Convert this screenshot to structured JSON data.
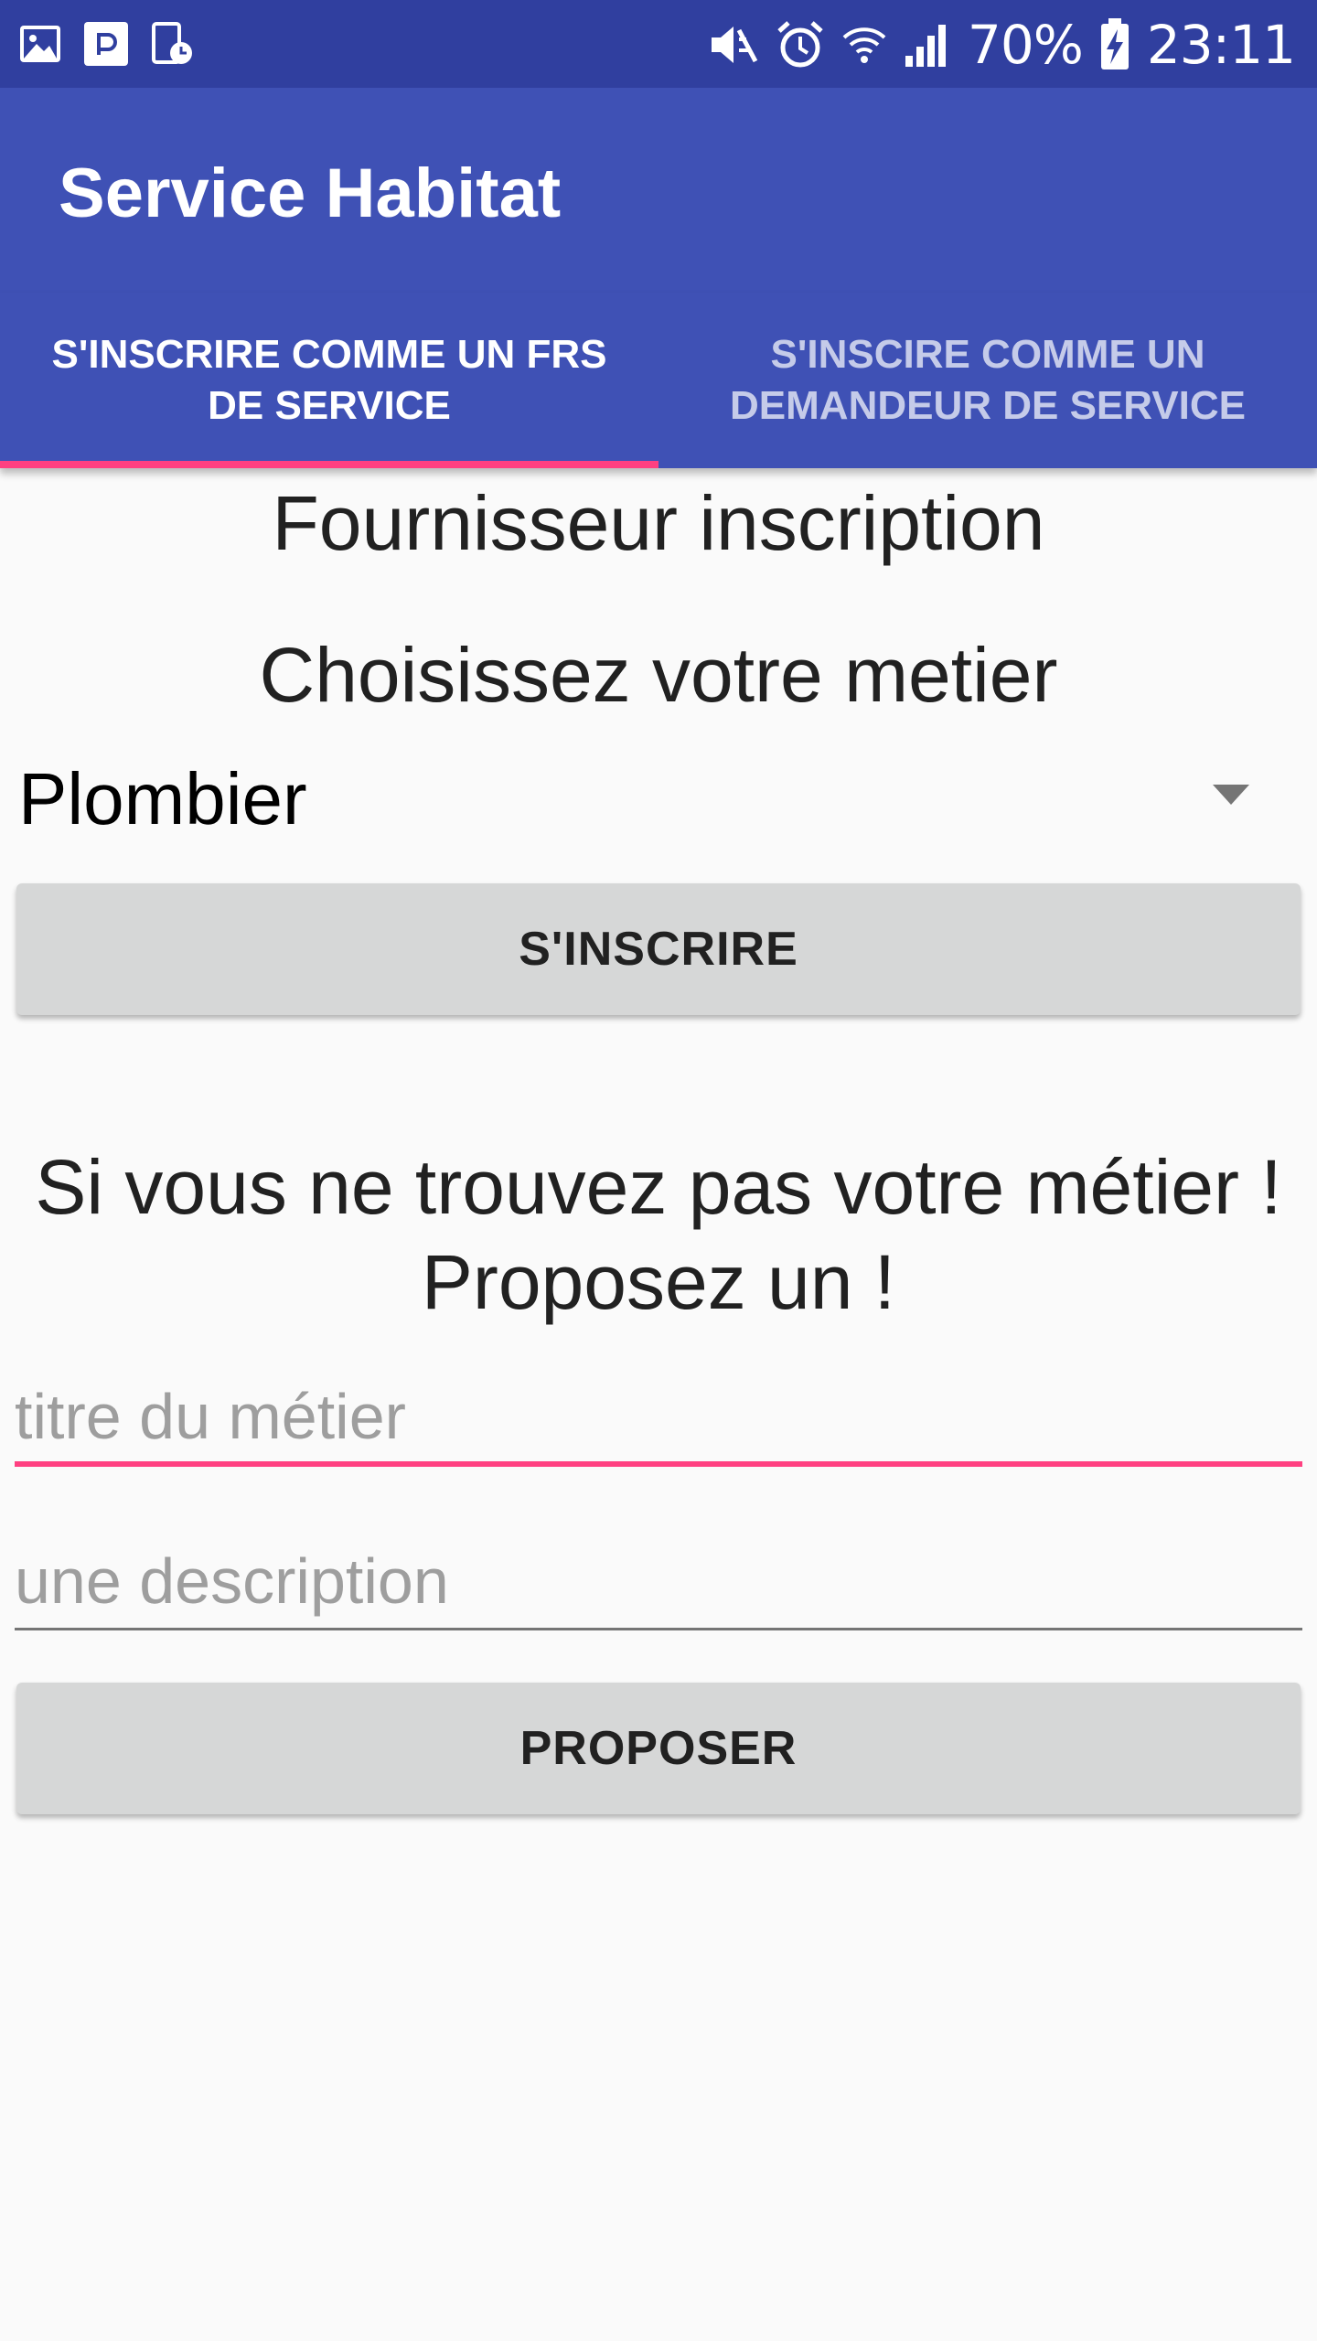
{
  "status_bar": {
    "battery": "70%",
    "time": "23:11",
    "icons": [
      "image-icon",
      "parking-app-icon",
      "screen-timer-icon",
      "mute-icon",
      "alarm-icon",
      "wifi-icon",
      "signal-icon",
      "battery-charging-icon"
    ]
  },
  "app_bar": {
    "title": "Service Habitat"
  },
  "tabs": [
    {
      "label": "S'INSCRIRE COMME UN FRS DE SERVICE",
      "selected": true
    },
    {
      "label": "S'INSCIRE COMME UN DEMANDEUR DE SERVICE",
      "selected": false
    }
  ],
  "main": {
    "title": "Fournisseur inscription",
    "choose_label": "Choisissez votre metier",
    "spinner_value": "Plombier",
    "register_button": "S'INSCRIRE",
    "prompt_line1": "Si vous ne trouvez pas votre métier !",
    "prompt_line2": "Proposez un !",
    "title_field": {
      "value": "",
      "placeholder": "titre du métier"
    },
    "description_field": {
      "value": "",
      "placeholder": "une description"
    },
    "propose_button": "PROPOSER"
  },
  "colors": {
    "status_bar": "#303f9f",
    "primary": "#3f51b5",
    "accent": "#ff4081",
    "button": "#d6d7d7",
    "background": "#fafafa"
  }
}
